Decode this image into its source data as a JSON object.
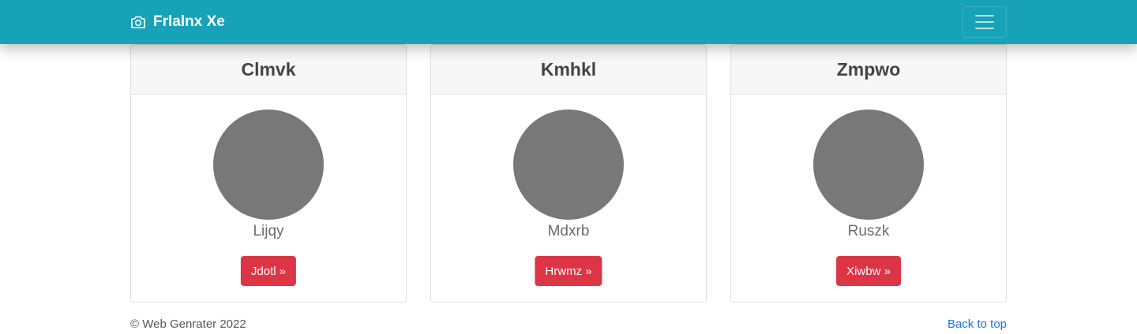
{
  "navbar": {
    "brand_icon": "camera-icon",
    "brand_text": "Frlalnx Xe",
    "toggle_icon": "hamburger-menu-icon",
    "color": "#17a2b8"
  },
  "cards": [
    {
      "title": "Clmvk",
      "text": "Lijqy",
      "button": "Jdotl »"
    },
    {
      "title": "Kmhkl",
      "text": "Mdxrb",
      "button": "Hrwmz »"
    },
    {
      "title": "Zmpwo",
      "text": "Ruszk",
      "button": "Xiwbw »"
    }
  ],
  "footer": {
    "copyright": "© Web Genrater 2022",
    "back_to_top": "Back to top"
  },
  "colors": {
    "button": "#dc3545",
    "avatar": "#787878",
    "link": "#1a73e8"
  }
}
